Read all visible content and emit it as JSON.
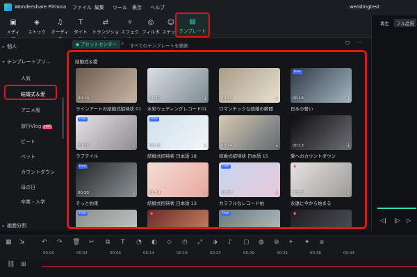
{
  "app": {
    "title": "Wondershare Filmora",
    "project": "weddingtest"
  },
  "menu": [
    "ファイル",
    "編集",
    "ツール",
    "表示",
    "ヘルプ"
  ],
  "toolbar": [
    {
      "label": "メディア",
      "icon": "media-icon",
      "glyph": "▣"
    },
    {
      "label": "ストック",
      "icon": "stock-icon",
      "glyph": "◈"
    },
    {
      "label": "オーディオ",
      "icon": "audio-icon",
      "glyph": "♫"
    },
    {
      "label": "タイトル",
      "icon": "title-icon",
      "glyph": "T"
    },
    {
      "label": "トランジション",
      "icon": "transition-icon",
      "glyph": "⇄"
    },
    {
      "label": "エフェクト",
      "icon": "effect-icon",
      "glyph": "✧"
    },
    {
      "label": "フィルター",
      "icon": "filter-icon",
      "glyph": "◎"
    },
    {
      "label": "ステッ…",
      "icon": "sticker-icon",
      "glyph": "☺"
    },
    {
      "label": "テンプレート",
      "icon": "template-icon",
      "glyph": "▤",
      "active": true
    }
  ],
  "sidebar": {
    "personal": "個人",
    "templates": "テンプレートプリ...",
    "items": [
      "人気",
      "結婚式＆愛",
      "アニメ風",
      "旅行Vlog",
      "ビート",
      "ペット",
      "カウントダウン",
      "母の日",
      "卒業・入学"
    ],
    "hot_badge": "HOT",
    "split": "画面分割"
  },
  "content": {
    "asset_tab": "アセットセンター",
    "search_placeholder": "すべてのテンプレートを検索",
    "section_title": "結婚式＆愛",
    "cards": [
      {
        "caption": "ラインアートの結婚式招待状 01",
        "duration": "00:10",
        "badge": "",
        "colors": [
          "#6b5a4e",
          "#c9b7a4"
        ]
      },
      {
        "caption": "水彩ウェディングレコード01",
        "duration": "00:10",
        "badge": "",
        "colors": [
          "#d9dfe3",
          "#7d8b93"
        ]
      },
      {
        "caption": "ロマンチックな結婚の瞬間",
        "duration": "00:10",
        "badge": "",
        "colors": [
          "#a99c87",
          "#e9e1d2"
        ]
      },
      {
        "caption": "日本の誓い",
        "duration": "00:16",
        "badge": "Free",
        "colors": [
          "#2e3a45",
          "#a5b7c2"
        ]
      },
      {
        "caption": "ラブテイル",
        "duration": "00:13",
        "badge": "Free",
        "colors": [
          "#e8e4ea",
          "#8f8a90"
        ]
      },
      {
        "caption": "結婚式招待状 日本語 18",
        "duration": "00:16",
        "badge": "Free",
        "colors": [
          "#cfe0ec",
          "#f2f6f8"
        ]
      },
      {
        "caption": "結婚式招待状 日本語 15",
        "duration": "00:14",
        "badge": "",
        "colors": [
          "#d8c9b2",
          "#5f6b73"
        ]
      },
      {
        "caption": "愛へのカウントダウン",
        "duration": "00:13",
        "badge": "",
        "colors": [
          "#0c0c0e",
          "#6d6e74"
        ]
      },
      {
        "caption": "そっと約束",
        "duration": "00:20",
        "badge": "Free",
        "colors": [
          "#232628",
          "#8d9296"
        ]
      },
      {
        "caption": "結婚式招待状 日本語 13",
        "duration": "00:14",
        "badge": "",
        "colors": [
          "#f3ddd3",
          "#e8a9a0"
        ]
      },
      {
        "caption": "カラフルなレコード帖",
        "duration": "00:26",
        "badge": "Free",
        "colors": [
          "#c7d6f0",
          "#e7c8d8"
        ]
      },
      {
        "caption": "永遠に今から始まる",
        "duration": "00:25",
        "badge": "gem",
        "colors": [
          "#e6e4e0",
          "#9c9a96"
        ]
      },
      {
        "caption": "",
        "duration": "",
        "badge": "Free",
        "colors": [
          "#8a8e8c",
          "#c8ccca"
        ]
      },
      {
        "caption": "",
        "duration": "",
        "badge": "gem",
        "colors": [
          "#6b2b28",
          "#d08b6a"
        ]
      },
      {
        "caption": "",
        "duration": "",
        "badge": "Free",
        "colors": [
          "#6a7a80",
          "#b9c3c7"
        ]
      },
      {
        "caption": "",
        "duration": "",
        "badge": "gem",
        "colors": [
          "#1e1e22",
          "#55565c"
        ]
      }
    ]
  },
  "preview": {
    "play_tab": "再生",
    "full_quality": "フル品質"
  },
  "timeline": {
    "ticks": [
      "00:00",
      "00:04",
      "00:09",
      "00:14",
      "00:19",
      "00:24",
      "00:29",
      "00:33",
      "00:38",
      "00:43"
    ]
  },
  "colors": {
    "accent": "#2ee0c0",
    "highlight": "#e0141b"
  }
}
